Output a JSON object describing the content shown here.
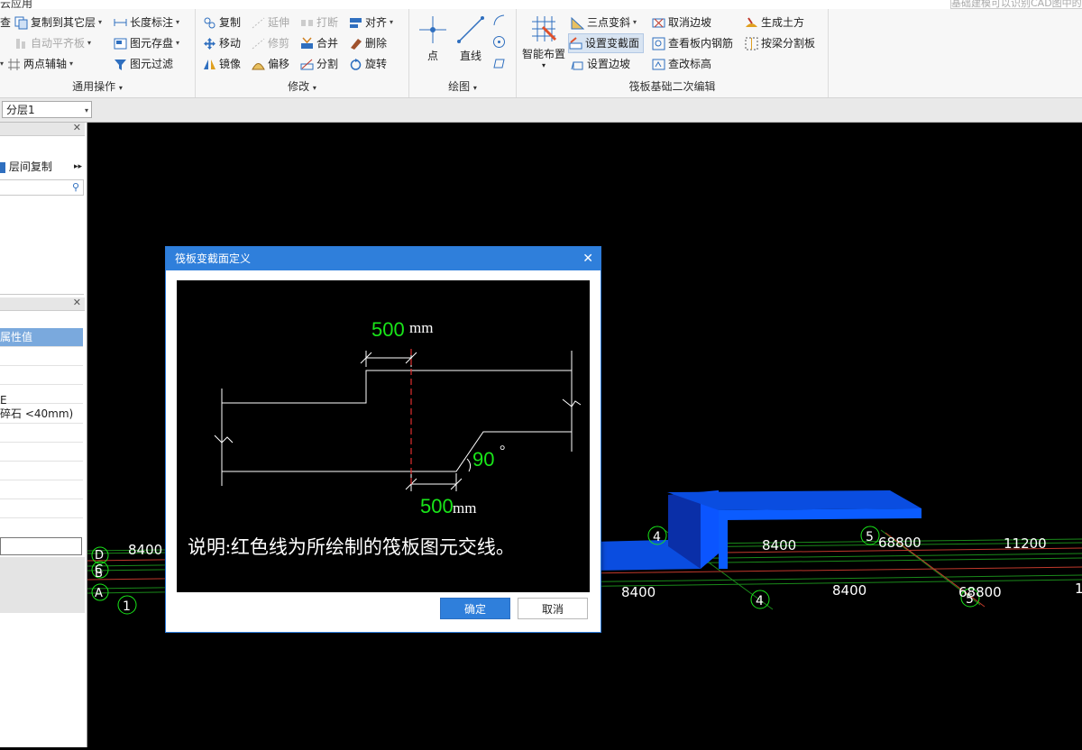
{
  "app": {
    "title_fragment": "云应用",
    "hint_fragment": "基础建模可以识别CAD图中的"
  },
  "ribbon": {
    "general": {
      "title": "通用操作",
      "items": [
        {
          "label": "复制到其它层",
          "dropdown": true
        },
        {
          "label": "长度标注",
          "dropdown": true
        },
        {
          "label": "自动平齐板",
          "dropdown": true,
          "disabled": true
        },
        {
          "label": "图元存盘",
          "dropdown": true
        },
        {
          "label": "两点辅轴",
          "dropdown": true
        },
        {
          "label": "图元过滤"
        }
      ],
      "left_fragments": [
        "查"
      ]
    },
    "modify": {
      "title": "修改",
      "items": [
        {
          "label": "复制"
        },
        {
          "label": "延伸",
          "disabled": true
        },
        {
          "label": "打断",
          "disabled": true
        },
        {
          "label": "对齐",
          "dropdown": true
        },
        {
          "label": "移动"
        },
        {
          "label": "修剪",
          "disabled": true
        },
        {
          "label": "合并"
        },
        {
          "label": "删除"
        },
        {
          "label": "镜像"
        },
        {
          "label": "偏移"
        },
        {
          "label": "分割"
        },
        {
          "label": "旋转"
        }
      ]
    },
    "draw": {
      "title": "绘图",
      "items": [
        {
          "label": "点"
        },
        {
          "label": "直线"
        }
      ]
    },
    "raft": {
      "title": "筏板基础二次编辑",
      "smart_label": "智能布置",
      "items": [
        {
          "label": "三点变斜",
          "dropdown": true
        },
        {
          "label": "取消边坡"
        },
        {
          "label": "生成土方"
        },
        {
          "label": "设置变截面",
          "selected": true
        },
        {
          "label": "查看板内钢筋"
        },
        {
          "label": "按梁分割板"
        },
        {
          "label": "设置边坡"
        },
        {
          "label": "查改标高"
        }
      ]
    }
  },
  "toolbar2": {
    "layer": "分层1"
  },
  "left_panel": {
    "copy_label": "层间复制",
    "prop_header": "属性值",
    "rows": [
      "",
      "",
      "",
      "E",
      "碎石 <40mm)",
      "",
      "",
      "",
      "",
      ""
    ]
  },
  "canvas": {
    "labels": [
      "8400",
      "8400",
      "8400",
      "8400",
      "68800",
      "11200",
      "68800",
      "1"
    ],
    "axis_numbers": [
      "1",
      "4",
      "4",
      "5",
      "5"
    ],
    "axis_letters": [
      "D",
      "C",
      "B",
      "A"
    ]
  },
  "dialog": {
    "title": "筏板变截面定义",
    "close": "✕",
    "top_value": "500",
    "bottom_value": "500",
    "unit": "mm",
    "angle": "90",
    "degree": "°",
    "note": "说明:红色线为所绘制的筏板图元交线。",
    "ok": "确定",
    "cancel": "取消"
  },
  "colors": {
    "accent": "#2f7fdb",
    "green": "#19e619",
    "slab_blue": "#0a4de0"
  }
}
